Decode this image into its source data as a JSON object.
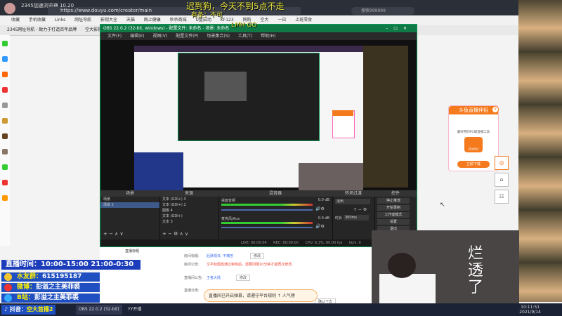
{
  "browser": {
    "title": "2345加速浏览器 10.20",
    "url": "https://www.douyu.com/creator/main",
    "search_placeholder": "搜索999999",
    "bookmarks": [
      "收藏",
      "手机收藏",
      "Links",
      "网址导航",
      "影视大全",
      "天猫",
      "网上健康",
      "秒杀商城",
      "U盘启动",
      "KF123",
      "网购",
      "空大",
      "一日",
      "上班零食"
    ],
    "tabs": [
      "2345网址导航 - 致力于打造百年品牌",
      "空大影视"
    ]
  },
  "overlay": {
    "line1": "迟到狗，今天不到5点不走",
    "line2": "有条：不可",
    "line3": "LMH GO"
  },
  "obs": {
    "title": "OBS 22.0.2 (32-bit, windows) - 配置文件: 未命名 - 场景: 未命名",
    "menu": [
      "文件(F)",
      "编辑(E)",
      "视图(V)",
      "配置文件(P)",
      "场景集合(S)",
      "工具(T)",
      "帮助(H)"
    ],
    "panels": {
      "scenes": {
        "header": "场景",
        "items": [
          "场景",
          "场景 2"
        ]
      },
      "sources": {
        "header": "来源",
        "items": [
          "文本 (GDI+) 3",
          "文本 (GDI+) 2",
          "图像 4",
          "文本 (GDI+)",
          "文本 3"
        ]
      },
      "mixer": {
        "header": "混音器",
        "channels": [
          "桌面音频",
          "麦克风/Aux"
        ],
        "db": [
          "0.0 dB",
          "0.0 dB"
        ]
      },
      "transitions": {
        "header": "转场过渡",
        "type": "淡出",
        "duration_label": "时长",
        "duration": "300ms"
      },
      "controls": {
        "header": "控件",
        "buttons": [
          "停止推流",
          "开始录制",
          "工作室模式",
          "设置",
          "退出"
        ]
      }
    },
    "status": {
      "live": "LIVE: 00:00:54",
      "rec": "REC: 00:00:00",
      "cpu": "CPU: 6.3%, 60.00 fps",
      "kbps": "kb/s: 0"
    }
  },
  "ad_card": {
    "title": "斗鱼直播伴侣",
    "subtitle": "最好用的PC端直播工具",
    "logo_text": "DOUYU",
    "button": "立即下载"
  },
  "page": {
    "label_title": "直播标题",
    "rows": [
      {
        "label": "房间标题:",
        "value": "后默观日, 不痛苦",
        "button": "修改"
      },
      {
        "label": "房间公告:",
        "value": "文字标题需通过审核后，需要间隔10分钟才能再次修改"
      },
      {
        "label": "直播间公告:",
        "value": "王者大陆",
        "button": "修改"
      },
      {
        "label": "直播分类:",
        "value": "后台管理",
        "button": "直播申请"
      }
    ],
    "sub_button": "确认下去"
  },
  "danmu": "直播间已开启弹幕，请遵守平台规则  ↑ 人气榜",
  "schedule": {
    "time_label": "直播时间：",
    "time_value": "10:00-15:00 21:00-0:30",
    "rows": [
      {
        "key": "水友群：",
        "value": "615195187"
      },
      {
        "key": "微博：",
        "value": "彭溢之主美菲裘"
      },
      {
        "key": "B站：",
        "value": "彭溢之主美菲裘"
      },
      {
        "key": "抖音：",
        "value": "空大首播2"
      }
    ]
  },
  "webcam_text": "烂\n透\n了",
  "taskbar": {
    "items": [
      "OBS 22.0.2 (32-bit)",
      "YY开播"
    ],
    "time": "10:11:51",
    "date": "2021/9/14"
  },
  "colors": {
    "obs_green": "#0f7a45",
    "douyu_orange": "#f57a1e",
    "schedule_blue": "#1f4fc0",
    "schedule_yellow": "#fff200"
  }
}
